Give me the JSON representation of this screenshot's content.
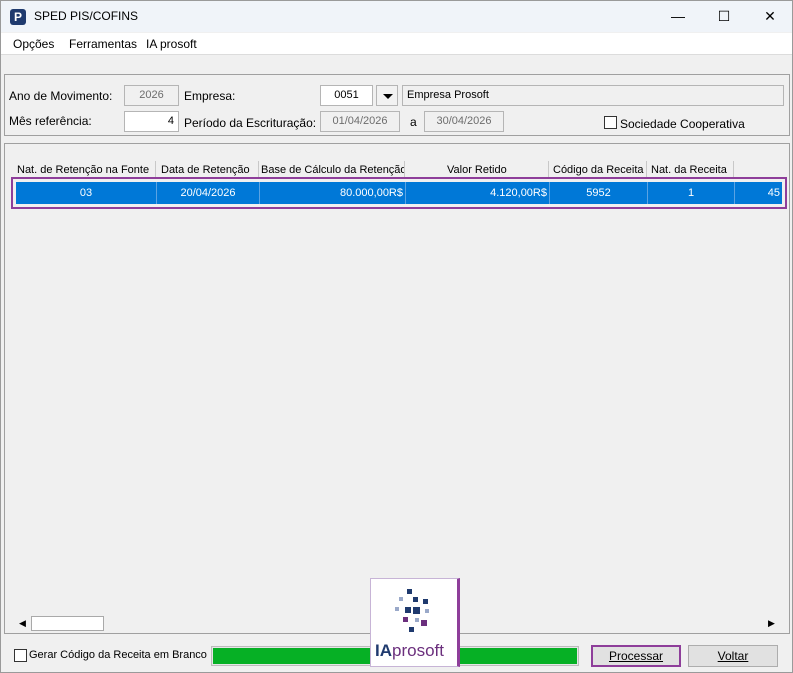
{
  "window": {
    "title": "SPED PIS/COFINS",
    "controls": {
      "minimize": "—",
      "maximize": "☐",
      "close": "✕"
    }
  },
  "menu": [
    "Opções",
    "Ferramentas",
    "IA prosoft"
  ],
  "form": {
    "ano_label": "Ano de Movimento:",
    "ano_value": "2026",
    "empresa_label": "Empresa:",
    "empresa_code": "0051",
    "empresa_name": "Empresa Prosoft",
    "mes_label": "Mês referência:",
    "mes_value": "4",
    "periodo_label": "Período da Escrituração:",
    "periodo_inicio": "01/04/2026",
    "periodo_sep": "a",
    "periodo_fim": "30/04/2026",
    "sociedade_label": "Sociedade Cooperativa",
    "sociedade_checked": false
  },
  "grid": {
    "columns": [
      "Nat. de Retenção na Fonte",
      "Data de Retenção",
      "Base de Cálculo da Retenção",
      "Valor Retido",
      "Código da Receita",
      "Nat. da Receita",
      ""
    ],
    "rows": [
      [
        "03",
        "20/04/2026",
        "80.000,00R$",
        "4.120,00R$",
        "5952",
        "1",
        "45"
      ]
    ]
  },
  "scrollbar": {
    "left_arrow": "◀",
    "right_arrow": "▶"
  },
  "footer": {
    "gerar_label": "Gerar Código da Receita em Branco",
    "gerar_checked": false,
    "progress_fraction": 1.0,
    "processar_label": "Processar",
    "voltar_label": "Voltar"
  },
  "logo": {
    "prefix": "IA",
    "suffix": "prosoft"
  },
  "colors": {
    "selection": "#0078d7",
    "highlight_border": "#8e3e9a",
    "progress": "#06b025",
    "brand_blue": "#1f3a6e",
    "brand_purple": "#6b2f7d"
  }
}
